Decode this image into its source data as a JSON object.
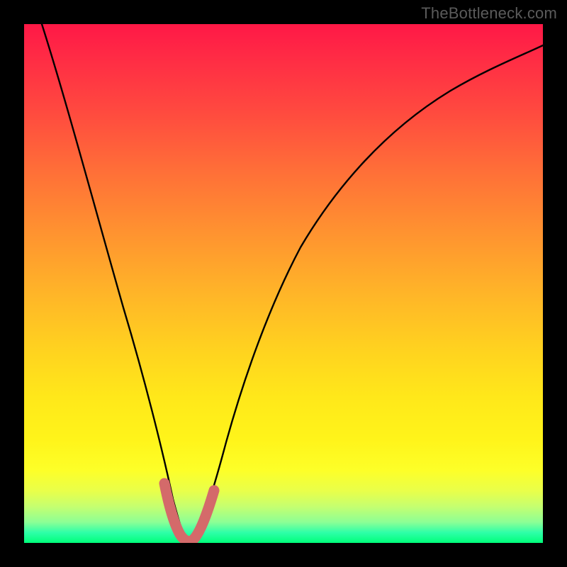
{
  "watermark": "TheBottleneck.com",
  "chart_data": {
    "type": "line",
    "title": "",
    "xlabel": "",
    "ylabel": "",
    "xlim": [
      0,
      1
    ],
    "ylim": [
      0,
      1
    ],
    "series": [
      {
        "name": "bottleneck-curve",
        "x": [
          0.035,
          0.06,
          0.09,
          0.12,
          0.15,
          0.18,
          0.21,
          0.235,
          0.26,
          0.275,
          0.29,
          0.3,
          0.31,
          0.32,
          0.335,
          0.355,
          0.38,
          0.41,
          0.45,
          0.5,
          0.56,
          0.63,
          0.71,
          0.8,
          0.9,
          1.0
        ],
        "y": [
          1.0,
          0.9,
          0.78,
          0.66,
          0.54,
          0.42,
          0.3,
          0.2,
          0.1,
          0.045,
          0.015,
          0.005,
          0.005,
          0.015,
          0.045,
          0.105,
          0.175,
          0.255,
          0.35,
          0.45,
          0.545,
          0.63,
          0.7,
          0.76,
          0.805,
          0.84
        ]
      },
      {
        "name": "valley-highlight",
        "x": [
          0.265,
          0.275,
          0.285,
          0.295,
          0.305,
          0.315,
          0.325,
          0.335,
          0.345,
          0.355
        ],
        "y": [
          0.085,
          0.055,
          0.03,
          0.012,
          0.004,
          0.004,
          0.012,
          0.032,
          0.06,
          0.095
        ]
      }
    ],
    "background": "vertical-heat-gradient",
    "annotations": []
  }
}
